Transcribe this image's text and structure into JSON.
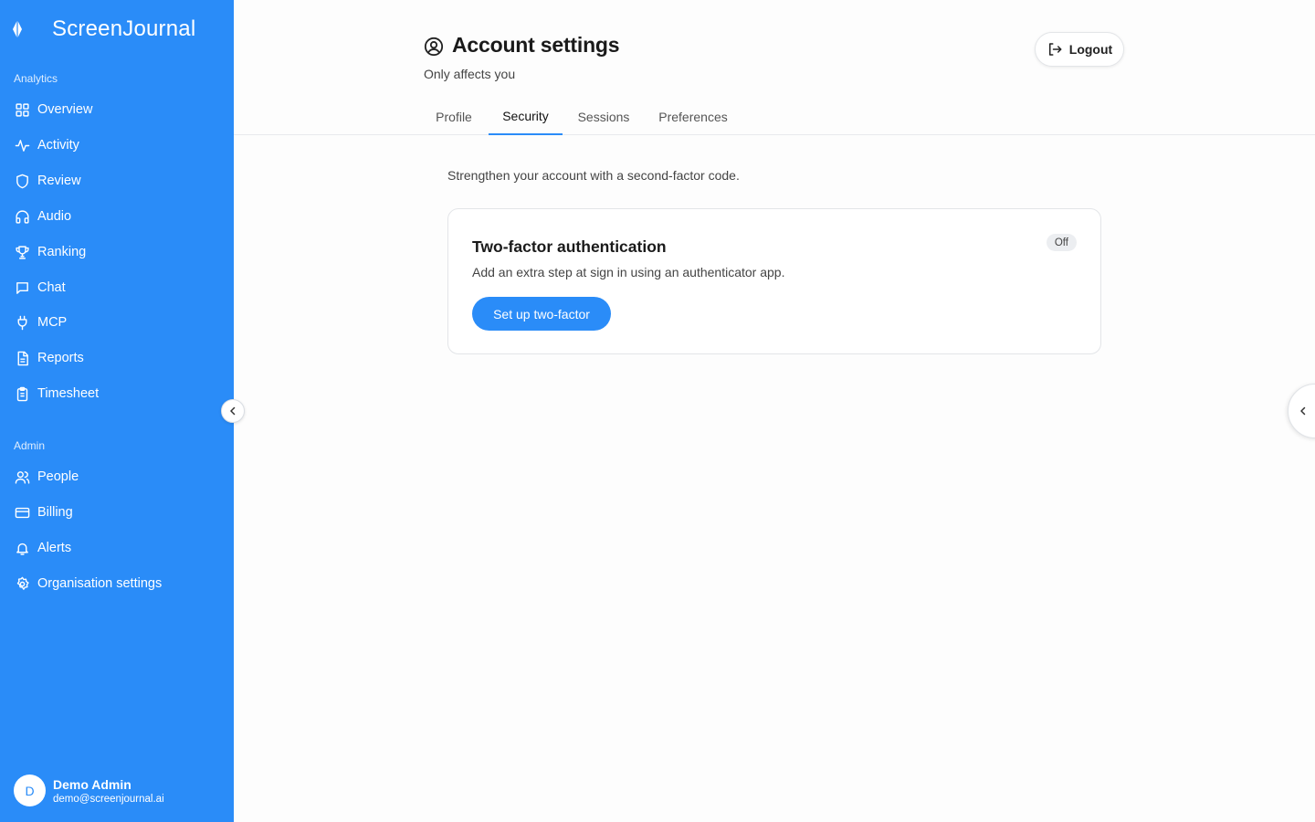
{
  "app": {
    "name": "ScreenJournal",
    "accent_color": "#2a8cf8"
  },
  "sidebar": {
    "section_analytics": "Analytics",
    "analytics_items": [
      {
        "label": "Overview",
        "icon": "grid-icon"
      },
      {
        "label": "Activity",
        "icon": "activity-icon"
      },
      {
        "label": "Review",
        "icon": "shield-icon"
      },
      {
        "label": "Audio",
        "icon": "headphones-icon"
      },
      {
        "label": "Ranking",
        "icon": "trophy-icon"
      },
      {
        "label": "Chat",
        "icon": "chat-icon"
      },
      {
        "label": "MCP",
        "icon": "plug-icon"
      },
      {
        "label": "Reports",
        "icon": "report-icon"
      },
      {
        "label": "Timesheet",
        "icon": "clipboard-icon"
      }
    ],
    "section_admin": "Admin",
    "admin_items": [
      {
        "label": "People",
        "icon": "users-icon"
      },
      {
        "label": "Billing",
        "icon": "credit-card-icon"
      },
      {
        "label": "Alerts",
        "icon": "bell-icon"
      },
      {
        "label": "Organisation settings",
        "icon": "gear-icon"
      }
    ],
    "user": {
      "initial": "D",
      "name": "Demo Admin",
      "email": "demo@screenjournal.ai"
    }
  },
  "header": {
    "title": "Account settings",
    "subtitle": "Only affects you",
    "logout_label": "Logout"
  },
  "tabs": [
    {
      "label": "Profile",
      "active": false
    },
    {
      "label": "Security",
      "active": true
    },
    {
      "label": "Sessions",
      "active": false
    },
    {
      "label": "Preferences",
      "active": false
    }
  ],
  "security": {
    "intro": "Strengthen your account with a second-factor code.",
    "card": {
      "title": "Two-factor authentication",
      "description": "Add an extra step at sign in using an authenticator app.",
      "status": "Off",
      "button_label": "Set up two-factor"
    }
  }
}
